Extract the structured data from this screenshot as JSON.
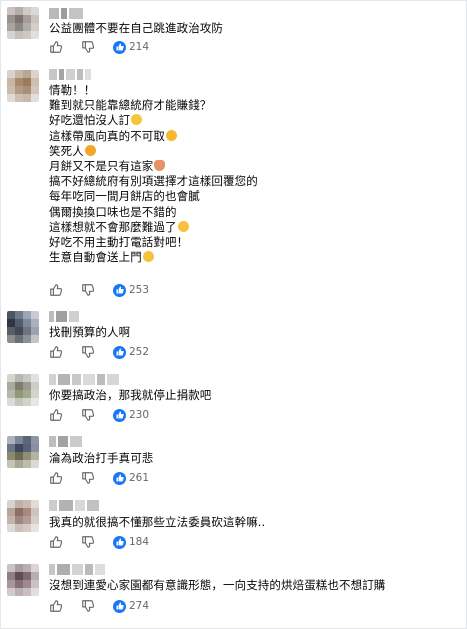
{
  "comments": [
    {
      "lines": [
        "公益團體不要在自己跳進政治攻防"
      ],
      "like_count": "214"
    },
    {
      "lines": [
        "情勒！！",
        "難到就只能靠總統府才能賺錢？",
        "好吃還怕沒人訂",
        "這樣帶風向真的不可取",
        "笑死人",
        "月餅又不是只有這家",
        "搞不好總統府有別項選擇才這樣回覆您的",
        "每年吃同一間月餅店的也會膩",
        "偶爾換換口味也是不錯的",
        "這樣想就不會那麼難過了",
        "好吃不用主動打電話對吧！",
        "生意自動會送上門"
      ],
      "like_count": "253"
    },
    {
      "lines": [
        "找刪預算的人啊"
      ],
      "like_count": "252"
    },
    {
      "lines": [
        "你要搞政治，那我就停止捐款吧"
      ],
      "like_count": "230"
    },
    {
      "lines": [
        "淪為政治打手真可悲"
      ],
      "like_count": "261"
    },
    {
      "lines": [
        "我真的就很搞不懂那些立法委員砍這幹嘛.."
      ],
      "like_count": "184"
    },
    {
      "lines": [
        "沒想到連愛心家園都有意識形態，一向支持的烘焙蛋糕也不想訂購"
      ],
      "like_count": "274"
    }
  ],
  "icons": {
    "like": "thumbs-up-outline-icon",
    "dislike": "thumbs-down-outline-icon",
    "reaction": "like-reaction-icon"
  },
  "colors": {
    "like_blue": "#1877f2",
    "muted_text": "#65676b"
  }
}
